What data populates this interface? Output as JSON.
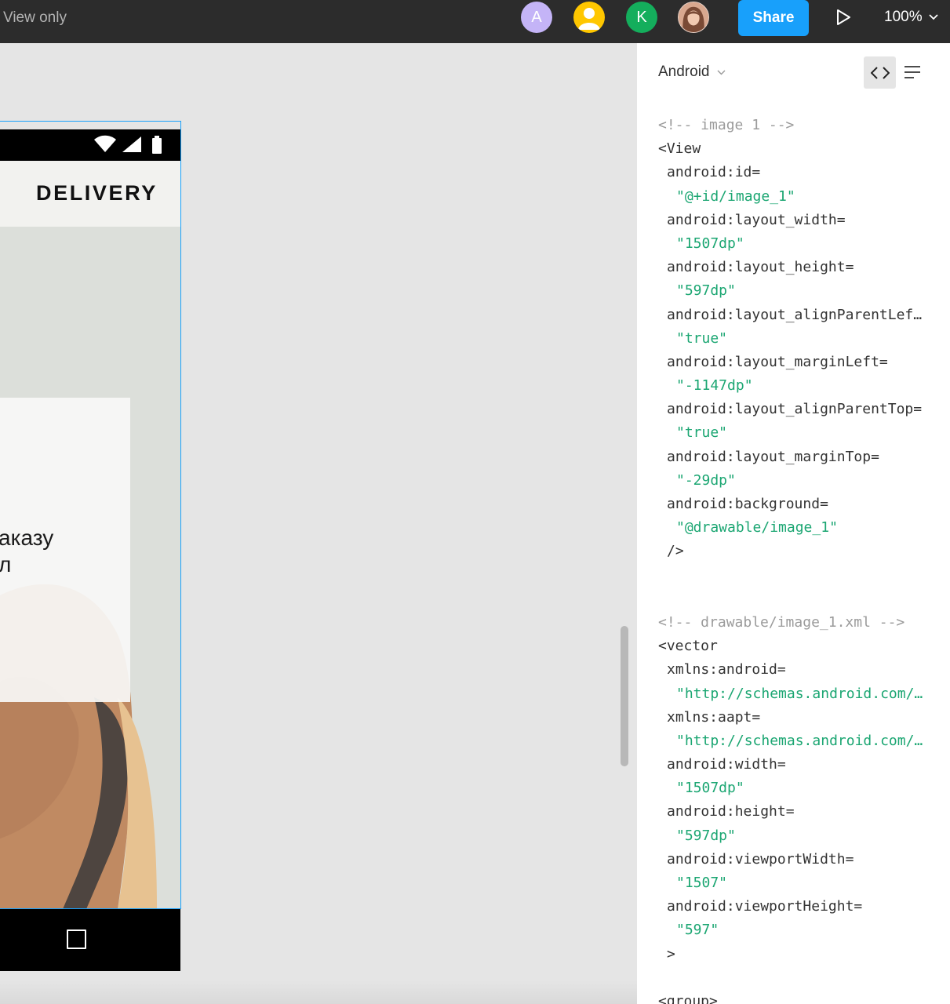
{
  "toolbar": {
    "view_mode": "View only",
    "avatars": [
      {
        "initial": "A",
        "color": "#c4b4f7"
      },
      {
        "initial": "",
        "color": "#ffc700"
      },
      {
        "initial": "K",
        "color": "#14ae5c"
      },
      {
        "initial": "",
        "color": "#c98f7c"
      }
    ],
    "share_label": "Share",
    "zoom": "100%"
  },
  "canvas": {
    "app_logo": "DELIVERY",
    "promo_text": "аказу\nл"
  },
  "panel": {
    "platform": "Android",
    "code_lines": [
      {
        "cls": "comment",
        "indent": 0,
        "text": "<!-- image 1 -->"
      },
      {
        "cls": "tag",
        "indent": 0,
        "text": "<View"
      },
      {
        "cls": "attr",
        "indent": 1,
        "text": "android:id="
      },
      {
        "cls": "val",
        "indent": 2,
        "text": "\"@+id/image_1\""
      },
      {
        "cls": "attr",
        "indent": 1,
        "text": "android:layout_width="
      },
      {
        "cls": "val",
        "indent": 2,
        "text": "\"1507dp\""
      },
      {
        "cls": "attr",
        "indent": 1,
        "text": "android:layout_height="
      },
      {
        "cls": "val",
        "indent": 2,
        "text": "\"597dp\""
      },
      {
        "cls": "attr",
        "indent": 1,
        "text": "android:layout_alignParentLef…"
      },
      {
        "cls": "val",
        "indent": 2,
        "text": "\"true\""
      },
      {
        "cls": "attr",
        "indent": 1,
        "text": "android:layout_marginLeft="
      },
      {
        "cls": "val",
        "indent": 2,
        "text": "\"-1147dp\""
      },
      {
        "cls": "attr",
        "indent": 1,
        "text": "android:layout_alignParentTop="
      },
      {
        "cls": "val",
        "indent": 2,
        "text": "\"true\""
      },
      {
        "cls": "attr",
        "indent": 1,
        "text": "android:layout_marginTop="
      },
      {
        "cls": "val",
        "indent": 2,
        "text": "\"-29dp\""
      },
      {
        "cls": "attr",
        "indent": 1,
        "text": "android:background="
      },
      {
        "cls": "val",
        "indent": 2,
        "text": "\"@drawable/image_1\""
      },
      {
        "cls": "tag",
        "indent": 1,
        "text": "/>"
      },
      {
        "cls": "blank",
        "indent": 0,
        "text": ""
      },
      {
        "cls": "blank",
        "indent": 0,
        "text": ""
      },
      {
        "cls": "comment",
        "indent": 0,
        "text": "<!-- drawable/image_1.xml -->"
      },
      {
        "cls": "tag",
        "indent": 0,
        "text": "<vector"
      },
      {
        "cls": "attr",
        "indent": 1,
        "text": "xmlns:android="
      },
      {
        "cls": "val",
        "indent": 2,
        "text": "\"http://schemas.android.com/…"
      },
      {
        "cls": "attr",
        "indent": 1,
        "text": "xmlns:aapt="
      },
      {
        "cls": "val",
        "indent": 2,
        "text": "\"http://schemas.android.com/…"
      },
      {
        "cls": "attr",
        "indent": 1,
        "text": "android:width="
      },
      {
        "cls": "val",
        "indent": 2,
        "text": "\"1507dp\""
      },
      {
        "cls": "attr",
        "indent": 1,
        "text": "android:height="
      },
      {
        "cls": "val",
        "indent": 2,
        "text": "\"597dp\""
      },
      {
        "cls": "attr",
        "indent": 1,
        "text": "android:viewportWidth="
      },
      {
        "cls": "val",
        "indent": 2,
        "text": "\"1507\""
      },
      {
        "cls": "attr",
        "indent": 1,
        "text": "android:viewportHeight="
      },
      {
        "cls": "val",
        "indent": 2,
        "text": "\"597\""
      },
      {
        "cls": "tag",
        "indent": 1,
        "text": ">"
      },
      {
        "cls": "blank",
        "indent": 0,
        "text": ""
      },
      {
        "cls": "tag",
        "indent": 0,
        "text": "<group>"
      }
    ]
  }
}
